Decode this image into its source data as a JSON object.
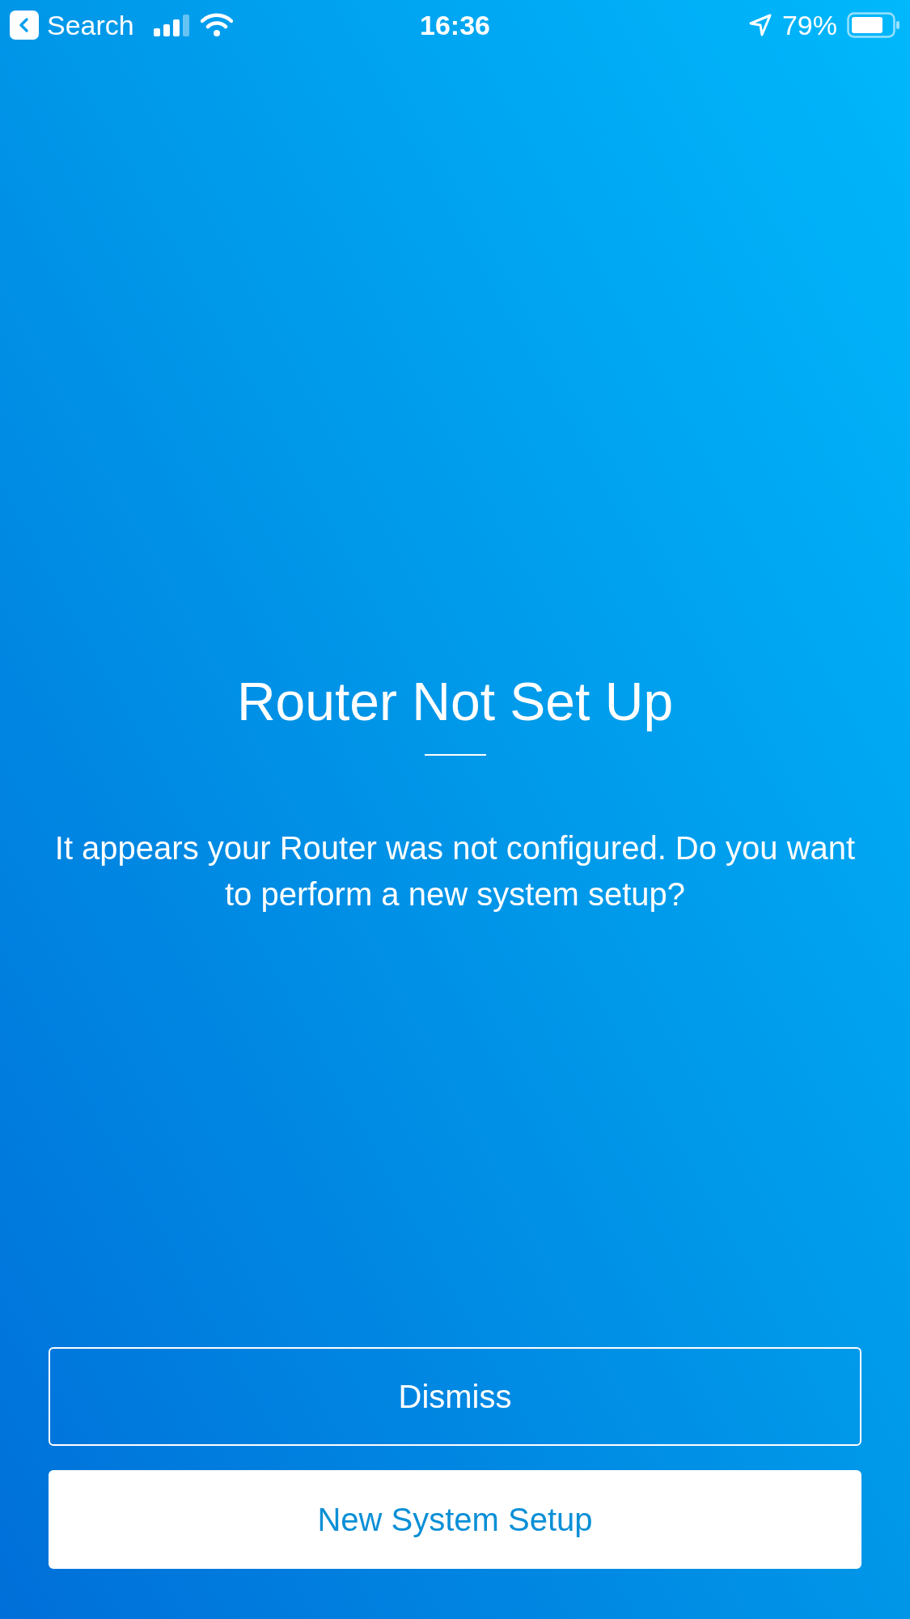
{
  "status_bar": {
    "back_label": "Search",
    "time": "16:36",
    "battery": "79%"
  },
  "title": "Router Not Set Up",
  "message": "It appears your Router was not configured. Do you want to perform a new system setup?",
  "buttons": [
    {
      "label": "Dismiss",
      "kind": "outline"
    },
    {
      "label": "New System Setup",
      "kind": "filled"
    }
  ]
}
